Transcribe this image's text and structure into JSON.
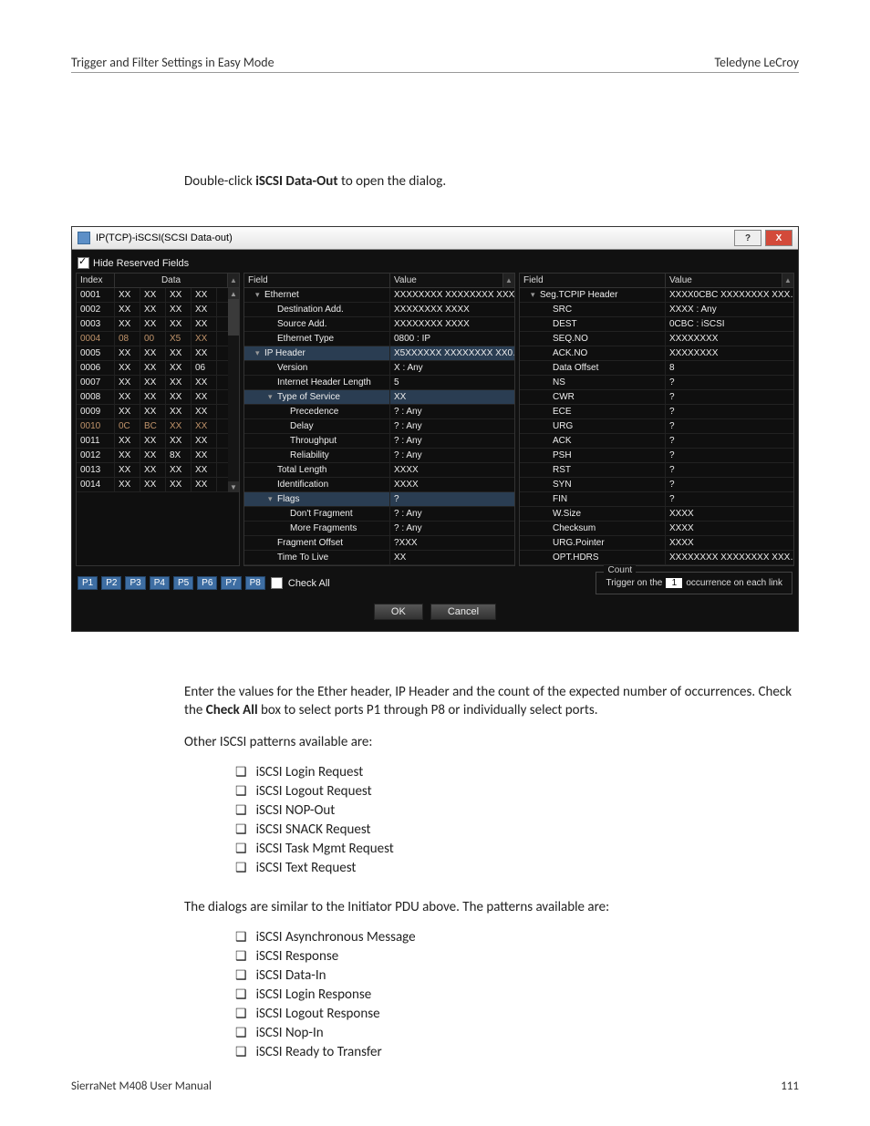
{
  "header": {
    "left": "Trigger and Filter Settings in Easy Mode",
    "right": "Teledyne LeCroy"
  },
  "instruction": {
    "prefix": "Double-click ",
    "bold": "iSCSI Data-Out",
    "suffix": " to open the dialog."
  },
  "dialog": {
    "title": "IP(TCP)-iSCSI(SCSI Data-out)",
    "help": "?",
    "close": "X",
    "hide_reserved": "Hide Reserved Fields",
    "left_headers": {
      "index": "Index",
      "data": "Data"
    },
    "left_rows": [
      {
        "idx": "0001",
        "d": [
          "XX",
          "XX",
          "XX",
          "XX"
        ],
        "hl": false
      },
      {
        "idx": "0002",
        "d": [
          "XX",
          "XX",
          "XX",
          "XX"
        ],
        "hl": false
      },
      {
        "idx": "0003",
        "d": [
          "XX",
          "XX",
          "XX",
          "XX"
        ],
        "hl": false
      },
      {
        "idx": "0004",
        "d": [
          "08",
          "00",
          "X5",
          "XX"
        ],
        "hl": true
      },
      {
        "idx": "0005",
        "d": [
          "XX",
          "XX",
          "XX",
          "XX"
        ],
        "hl": false
      },
      {
        "idx": "0006",
        "d": [
          "XX",
          "XX",
          "XX",
          "06"
        ],
        "hl": false
      },
      {
        "idx": "0007",
        "d": [
          "XX",
          "XX",
          "XX",
          "XX"
        ],
        "hl": false
      },
      {
        "idx": "0008",
        "d": [
          "XX",
          "XX",
          "XX",
          "XX"
        ],
        "hl": false
      },
      {
        "idx": "0009",
        "d": [
          "XX",
          "XX",
          "XX",
          "XX"
        ],
        "hl": false
      },
      {
        "idx": "0010",
        "d": [
          "0C",
          "BC",
          "XX",
          "XX"
        ],
        "hl": true
      },
      {
        "idx": "0011",
        "d": [
          "XX",
          "XX",
          "XX",
          "XX"
        ],
        "hl": false
      },
      {
        "idx": "0012",
        "d": [
          "XX",
          "XX",
          "8X",
          "XX"
        ],
        "hl": false
      },
      {
        "idx": "0013",
        "d": [
          "XX",
          "XX",
          "XX",
          "XX"
        ],
        "hl": false
      },
      {
        "idx": "0014",
        "d": [
          "XX",
          "XX",
          "XX",
          "XX"
        ],
        "hl": false
      }
    ],
    "mid_headers": {
      "field": "Field",
      "value": "Value"
    },
    "mid_rows": [
      {
        "f": "Ethernet",
        "v": "XXXXXXXX XXXXXXXX XXX…",
        "ind": 0,
        "caret": "▾"
      },
      {
        "f": "Destination Add.",
        "v": "XXXXXXXX XXXX",
        "ind": 1
      },
      {
        "f": "Source Add.",
        "v": "XXXXXXXX XXXX",
        "ind": 1
      },
      {
        "f": "Ethernet Type",
        "v": "0800 : IP",
        "ind": 1
      },
      {
        "f": "IP Header",
        "v": "X5XXXXXX XXXXXXXX XX0…",
        "ind": 0,
        "caret": "▾",
        "hl": true
      },
      {
        "f": "Version",
        "v": "X : Any",
        "ind": 1
      },
      {
        "f": "Internet Header Length",
        "v": "5",
        "ind": 1
      },
      {
        "f": "Type of Service",
        "v": "XX",
        "ind": 1,
        "caret": "▾",
        "hl": true
      },
      {
        "f": "Precedence",
        "v": "? : Any",
        "ind": 2
      },
      {
        "f": "Delay",
        "v": "? : Any",
        "ind": 2
      },
      {
        "f": "Throughput",
        "v": "? : Any",
        "ind": 2
      },
      {
        "f": "Reliability",
        "v": "? : Any",
        "ind": 2
      },
      {
        "f": "Total Length",
        "v": "XXXX",
        "ind": 1
      },
      {
        "f": "Identification",
        "v": "XXXX",
        "ind": 1
      },
      {
        "f": "Flags",
        "v": "?",
        "ind": 1,
        "caret": "▾",
        "hl": true
      },
      {
        "f": "Don't Fragment",
        "v": "? : Any",
        "ind": 2
      },
      {
        "f": "More Fragments",
        "v": "? : Any",
        "ind": 2
      },
      {
        "f": "Fragment Offset",
        "v": "?XXX",
        "ind": 1
      },
      {
        "f": "Time To Live",
        "v": "XX",
        "ind": 1
      }
    ],
    "right_headers": {
      "field": "Field",
      "value": "Value"
    },
    "right_rows": [
      {
        "f": "Seg.TCPIP Header",
        "v": "XXXX0CBC XXXXXXXX XXX…",
        "ind": 0,
        "caret": "▾"
      },
      {
        "f": "SRC",
        "v": "XXXX : Any",
        "ind": 1
      },
      {
        "f": "DEST",
        "v": "0CBC : iSCSI",
        "ind": 1
      },
      {
        "f": "SEQ.NO",
        "v": "XXXXXXXX",
        "ind": 1
      },
      {
        "f": "ACK.NO",
        "v": "XXXXXXXX",
        "ind": 1
      },
      {
        "f": "Data Offset",
        "v": "8",
        "ind": 1
      },
      {
        "f": "NS",
        "v": "?",
        "ind": 1
      },
      {
        "f": "CWR",
        "v": "?",
        "ind": 1
      },
      {
        "f": "ECE",
        "v": "?",
        "ind": 1
      },
      {
        "f": "URG",
        "v": "?",
        "ind": 1
      },
      {
        "f": "ACK",
        "v": "?",
        "ind": 1
      },
      {
        "f": "PSH",
        "v": "?",
        "ind": 1
      },
      {
        "f": "RST",
        "v": "?",
        "ind": 1
      },
      {
        "f": "SYN",
        "v": "?",
        "ind": 1
      },
      {
        "f": "FIN",
        "v": "?",
        "ind": 1
      },
      {
        "f": "W.Size",
        "v": "XXXX",
        "ind": 1
      },
      {
        "f": "Checksum",
        "v": "XXXX",
        "ind": 1
      },
      {
        "f": "URG.Pointer",
        "v": "XXXX",
        "ind": 1
      },
      {
        "f": "OPT.HDRS",
        "v": "XXXXXXXX XXXXXXXX XXX…",
        "ind": 1
      }
    ],
    "ports": [
      "P1",
      "P2",
      "P3",
      "P4",
      "P5",
      "P6",
      "P7",
      "P8"
    ],
    "check_all": "Check All",
    "count_legend": "Count",
    "trigger_prefix": "Trigger on the",
    "trigger_value": "1",
    "trigger_suffix": "occurrence on each link",
    "ok": "OK",
    "cancel": "Cancel"
  },
  "para1_a": "Enter the values for the Ether header, IP Header and the count of the expected number of occurrences. Check the ",
  "para1_bold": "Check All",
  "para1_b": " box to select ports P1 through P8 or individually select ports.",
  "para2": "Other ISCSI patterns available are:",
  "bullets1": [
    "iSCSI Login Request",
    "iSCSI Logout Request",
    "iSCSI NOP-Out",
    "iSCSI SNACK Request",
    "iSCSI Task Mgmt Request",
    "iSCSI Text Request"
  ],
  "para3": "The dialogs are similar to the Initiator PDU above. The patterns available are:",
  "bullets2": [
    "iSCSI Asynchronous Message",
    "iSCSI Response",
    "iSCSI Data-In",
    "iSCSI Login Response",
    "iSCSI Logout Response",
    "iSCSI Nop-In",
    "iSCSI Ready to Transfer"
  ],
  "footer": {
    "left": "SierraNet M408 User Manual",
    "right": "111"
  }
}
